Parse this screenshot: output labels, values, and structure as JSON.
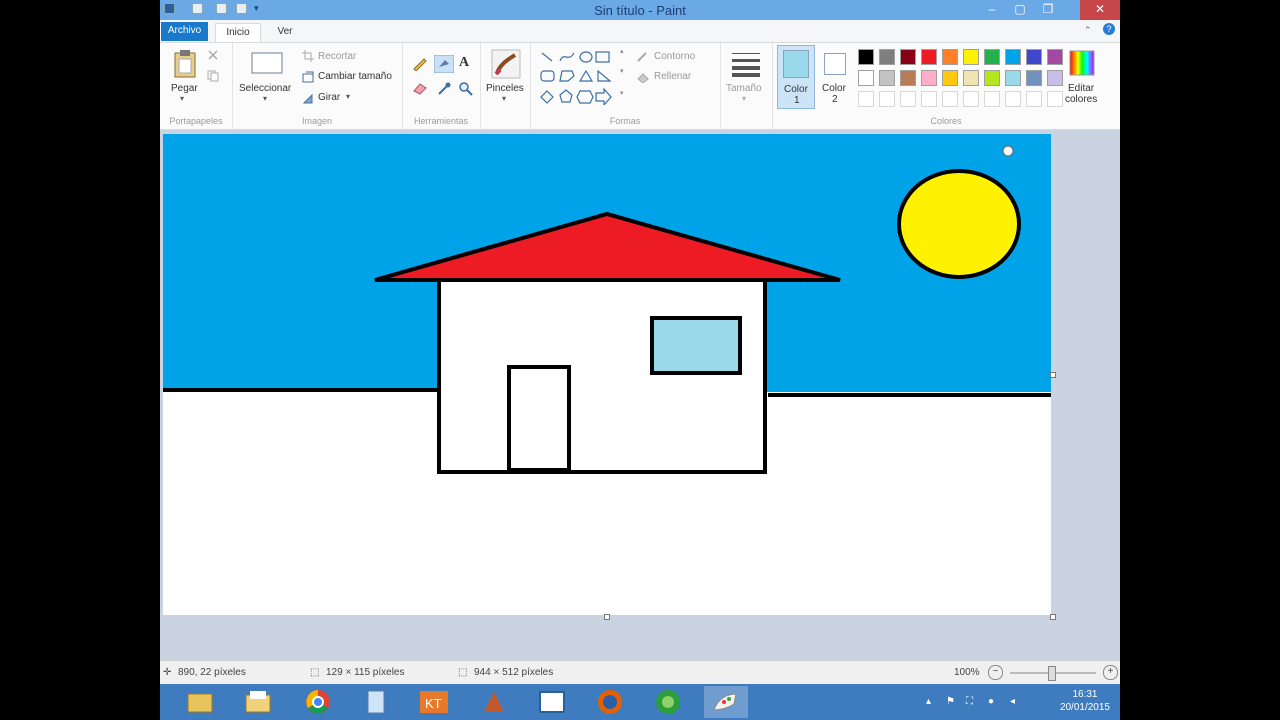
{
  "window": {
    "title": "Sin título - Paint"
  },
  "tabs": {
    "file": "Archivo",
    "home": "Inicio",
    "view": "Ver"
  },
  "clipboard": {
    "paste": "Pegar",
    "group": "Portapapeles"
  },
  "image": {
    "select": "Seleccionar",
    "crop": "Recortar",
    "resize": "Cambiar tamaño",
    "rotate": "Girar",
    "group": "Imagen"
  },
  "tools": {
    "group": "Herramientas"
  },
  "brushes": {
    "label": "Pinceles"
  },
  "shapes": {
    "outline": "Contorno",
    "fill": "Rellenar",
    "group": "Formas"
  },
  "size": {
    "label": "Tamaño"
  },
  "colors": {
    "color1_label": "Color",
    "color1_num": "1",
    "color2_label": "Color",
    "color2_num": "2",
    "edit_label1": "Editar",
    "edit_label2": "colores",
    "group": "Colores",
    "color1": "#99d9ea",
    "color2": "#ffffff",
    "palette": [
      "#000000",
      "#7f7f7f",
      "#880015",
      "#ed1c24",
      "#ff7f27",
      "#fff200",
      "#22b14c",
      "#00a2e8",
      "#3f48cc",
      "#a349a4",
      "#ffffff",
      "#c3c3c3",
      "#b97a57",
      "#ffaec9",
      "#ffc90e",
      "#efe4b0",
      "#b5e61d",
      "#99d9ea",
      "#7092be",
      "#c8bfe7"
    ]
  },
  "drawing": {
    "sky": "#00a2e8",
    "ground": "#ffffff",
    "roof": "#ed1c24",
    "sun": "#fff200",
    "window": "#99d9ea",
    "outline": "#000000"
  },
  "status": {
    "cursor": "890, 22 píxeles",
    "selection": "129 × 115 píxeles",
    "size": "944 × 512 píxeles",
    "zoom": "100%"
  },
  "taskbar": {
    "time": "16:31",
    "date": "20/01/2015"
  }
}
